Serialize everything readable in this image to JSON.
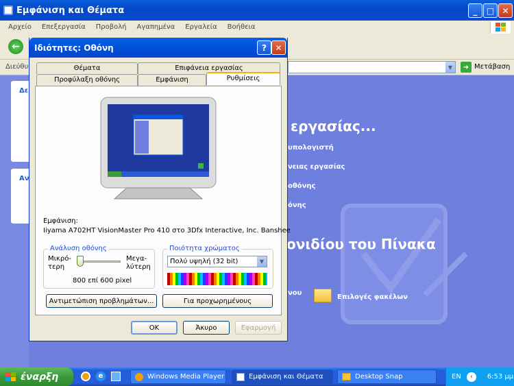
{
  "window": {
    "title": "Εμφάνιση και Θέματα"
  },
  "menu": [
    "Αρχείο",
    "Επεξεργασία",
    "Προβολή",
    "Αγαπημένα",
    "Εργαλεία",
    "Βοήθεια"
  ],
  "address": {
    "label": "Διεύθυν",
    "go": "Μετάβαση"
  },
  "background": {
    "heading1": "εργασίας...",
    "links": [
      "υπολογιστή",
      "νειας εργασίας",
      "οθόνης",
      "όνης"
    ],
    "heading2": "ονιδίου του Πίνακα",
    "link_left": "νου",
    "folder_options": "Επιλογές φακέλων",
    "left_panel_titles": [
      "Δε",
      "Αν"
    ]
  },
  "dialog": {
    "title": "Ιδιότητες: Οθόνη",
    "tabs_row1": [
      "Θέματα",
      "Επιφάνεια εργασίας"
    ],
    "tabs_row2": [
      "Προφύλαξη οθόνης",
      "Εμφάνιση",
      "Ρυθμίσεις"
    ],
    "display_label": "Εμφάνιση:",
    "display_value": "Iiyama A702HT VisionMaster Pro 410 στο 3Dfx Interactive, Inc. Banshee",
    "resolution": {
      "group": "Ανάλυση οθόνης",
      "less": "Μικρό-\nτερη",
      "more": "Μεγα-\nλύτερη",
      "value": "800 επί 600 pixel",
      "slider_level": 0.0
    },
    "color": {
      "group": "Ποιότητα χρώματος",
      "selected": "Πολύ υψηλή (32 bit)"
    },
    "troubleshoot": "Αντιμετώπιση προβλημάτων...",
    "advanced": "Για προχωρημένους",
    "ok": "OK",
    "cancel": "Άκυρο",
    "apply": "Εφαρμογή"
  },
  "taskbar": {
    "start": "έναρξη",
    "tasks": [
      "Windows Media Player",
      "Εμφάνιση και Θέματα",
      "Desktop Snap"
    ],
    "lang": "EN",
    "time": "6:53 μμ"
  },
  "colors": {
    "xp_blue": "#245edb",
    "content_bg": "#6f7fdd",
    "dialog_bg": "#ece9d8"
  }
}
